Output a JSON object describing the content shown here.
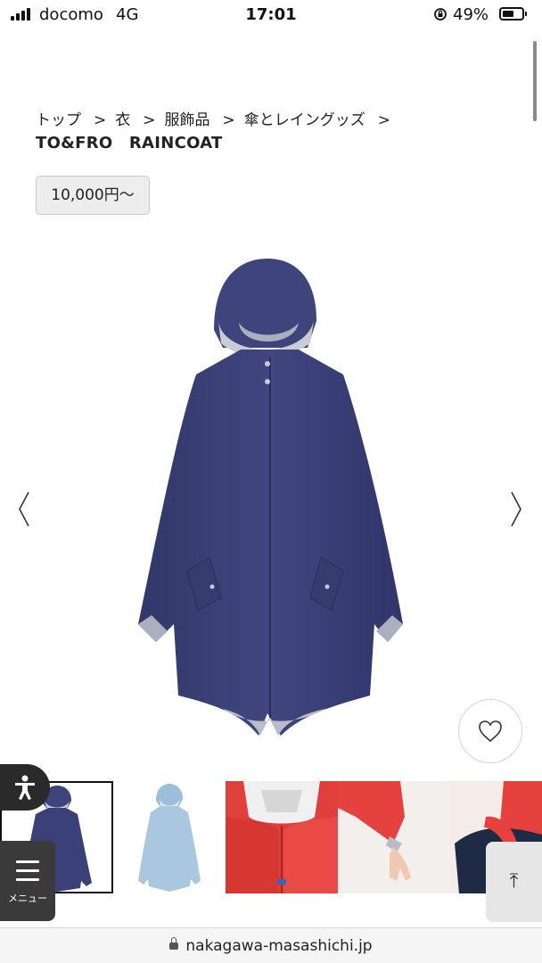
{
  "status_bar": {
    "carrier": "docomo",
    "network": "4G",
    "time": "17:01",
    "battery_percent": "49%",
    "battery_level": 0.49
  },
  "breadcrumb": {
    "items": [
      "トップ",
      "衣",
      "服飾品",
      "傘とレイングッズ"
    ],
    "separator": ">"
  },
  "product": {
    "title": "TO&FRO　RAINCOAT",
    "price": "10,000円〜",
    "main_image_icon": "navy-raincoat-image"
  },
  "gallery": {
    "prev_icon": "chevron-left-icon",
    "next_icon": "chevron-right-icon",
    "thumbnails": [
      {
        "icon": "navy-raincoat-thumbnail",
        "selected": true
      },
      {
        "icon": "light-blue-raincoat-thumbnail",
        "selected": false
      },
      {
        "icon": "red-raincoat-collar-thumbnail",
        "selected": false
      },
      {
        "icon": "red-raincoat-sleeve-thumbnail",
        "selected": false
      },
      {
        "icon": "red-raincoat-side-thumbnail",
        "selected": false
      }
    ]
  },
  "favorite": {
    "icon": "heart-icon"
  },
  "floating": {
    "accessibility_icon": "accessibility-icon",
    "menu_label": "メニュー",
    "scroll_top_icon": "arrow-up-icon",
    "scroll_top_glyph": "⤒"
  },
  "browser": {
    "url": "nakagawa-masashichi.jp"
  },
  "colors": {
    "coat_navy": "#3b4078",
    "coat_light_blue": "#a9c8e0",
    "coat_red": "#e8413e"
  }
}
